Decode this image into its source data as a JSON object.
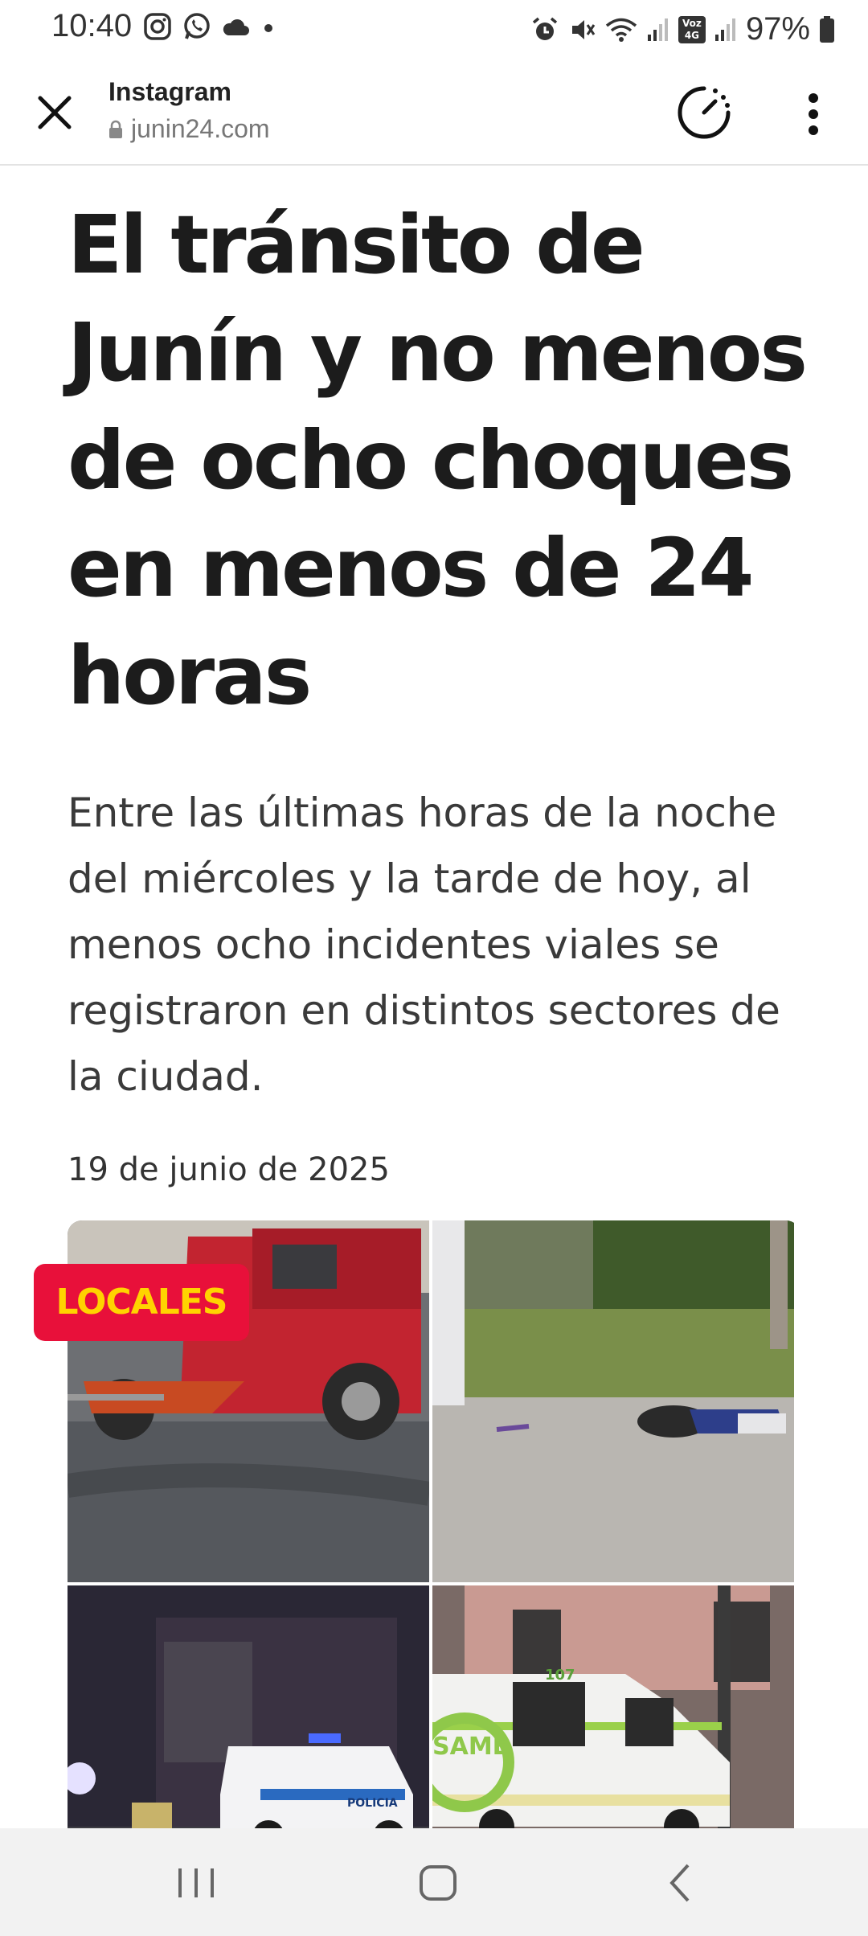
{
  "status_bar": {
    "time": "10:40",
    "battery": "97%",
    "left_icons": [
      "instagram-icon",
      "whatsapp-icon",
      "cloud-icon",
      "dot-icon"
    ],
    "right_icons": [
      "alarm-icon",
      "mute-icon",
      "wifi-icon",
      "signal-icon",
      "volte-icon",
      "signal-icon",
      "battery-icon"
    ],
    "network_badge": "Voz 4G"
  },
  "toolbar": {
    "app_title": "Instagram",
    "url": "junin24.com"
  },
  "article": {
    "headline": "El tránsito de Junín y no menos de ocho choques en menos de 24 horas",
    "lead": "Entre las últimas horas de la noche del miércoles y la tarde de hoy, al menos ocho incidentes viales se registraron en distintos sectores de la ciudad.",
    "date": "19 de junio de 2025",
    "category_badge": "LOCALES",
    "photo_labels": {
      "police": "POLICIA",
      "ambulance_brand": "SAME",
      "ambulance_number": "107"
    }
  },
  "colors": {
    "badge_bg": "#e8103a",
    "badge_text": "#ffd300"
  }
}
